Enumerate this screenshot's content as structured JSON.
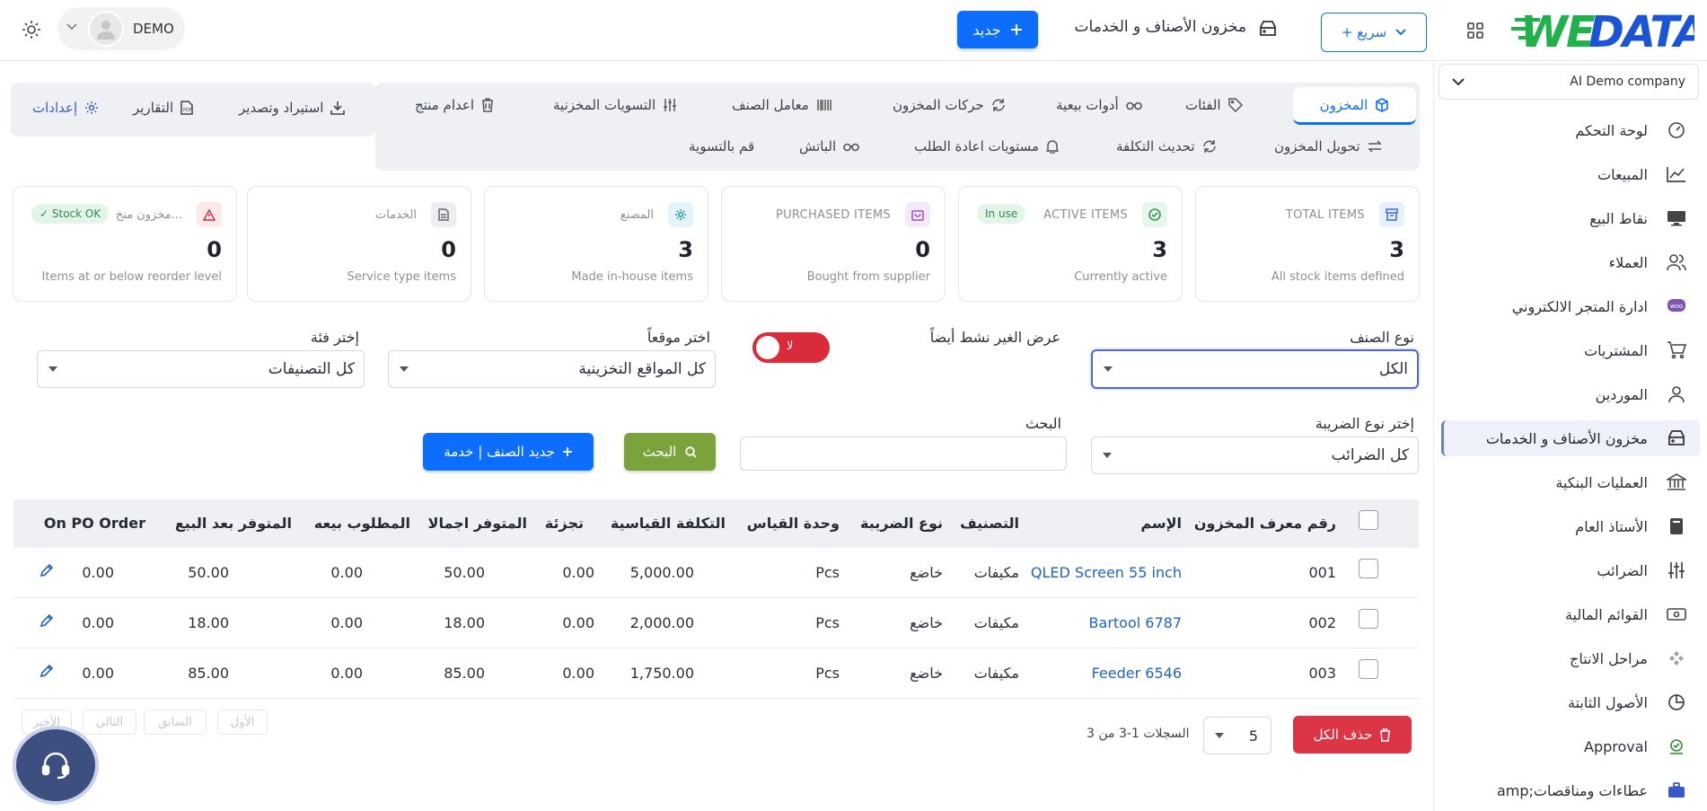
{
  "header": {
    "logo_text": "WE DATA",
    "quick_label": "+ سريع",
    "page_title": "مخزون الأصناف و الخدمات",
    "new_label": "جديد",
    "user_name": "DEMO"
  },
  "sidebar": {
    "company": "AI Demo company",
    "items": [
      {
        "label": "لوحة التحكم",
        "icon": "gauge-icon"
      },
      {
        "label": "المبيعات",
        "icon": "chart-line-icon"
      },
      {
        "label": "نقاط البيع",
        "icon": "monitor-icon"
      },
      {
        "label": "العملاء",
        "icon": "users-icon"
      },
      {
        "label": "ادارة المتجر الالكتروني",
        "icon": "woo-icon"
      },
      {
        "label": "المشتريات",
        "icon": "cart-icon"
      },
      {
        "label": "الموردين",
        "icon": "user-icon"
      },
      {
        "label": "مخزون الأصناف و الخدمات",
        "icon": "inventory-icon"
      },
      {
        "label": "العمليات البنكية",
        "icon": "bank-icon"
      },
      {
        "label": "الأستاذ العام",
        "icon": "book-icon"
      },
      {
        "label": "الضرائب",
        "icon": "sliders-icon"
      },
      {
        "label": "القوائم المالية",
        "icon": "cash-icon"
      },
      {
        "label": "مراحل الانتاج",
        "icon": "diamonds-icon"
      },
      {
        "label": "الأصول الثابتة",
        "icon": "pie-icon"
      },
      {
        "label": "Approval",
        "icon": "approval-icon"
      },
      {
        "label": "amp;عطاءات ومناقصات",
        "icon": "briefcase-icon"
      }
    ]
  },
  "tabs": {
    "row1": [
      "المخزون",
      "الفئات",
      "أدوات بيعية",
      "حركات المخزون",
      "معامل الصنف",
      "التسويات المخزنية",
      "اعدام منتج"
    ],
    "row2": [
      "تحويل المخزون",
      "تحديث التكلفة",
      "مستويات اعادة الطلب",
      "الباتش",
      "قم بالتسوية"
    ],
    "left": [
      "استيراد وتصدير",
      "التقارير",
      "إعدادات"
    ]
  },
  "cards": [
    {
      "title": "TOTAL ITEMS",
      "value": "3",
      "sub": "All stock items defined",
      "badge": ""
    },
    {
      "title": "ACTIVE ITEMS",
      "value": "3",
      "sub": "Currently active",
      "badge": "In use"
    },
    {
      "title": "PURCHASED ITEMS",
      "value": "0",
      "sub": "Bought from supplier",
      "badge": ""
    },
    {
      "title": "المصنع",
      "value": "3",
      "sub": "Made in-house items",
      "badge": ""
    },
    {
      "title": "الخدمات",
      "value": "0",
      "sub": "Service type items",
      "badge": ""
    },
    {
      "title": "مخزون منخ...",
      "value": "0",
      "sub": "Items at or below reorder level",
      "badge": "✓ Stock OK"
    }
  ],
  "filters": {
    "item_type_label": "نوع الصنف",
    "item_type_value": "الكل",
    "show_inactive_label": "عرض الغير نشط أيضاً",
    "toggle_label": "لا",
    "location_label": "اختر موقعاً",
    "location_value": "كل المواقع التخزينية",
    "category_label": "إختر فئة",
    "category_value": "كل التصنيفات",
    "tax_label": "إختر نوع الضريبة",
    "tax_value": "كل الضرائب",
    "search_label": "البحث",
    "search_btn": "البحث",
    "new_item_btn": "جديد الصنف | خدمة"
  },
  "table": {
    "headers": [
      "رقم معرف المخزون",
      "الإسم",
      "التصنيف",
      "نوع الضريبة",
      "وحدة القياس",
      "التكلفة القياسية",
      "تجزئة",
      "المتوفر اجمالا",
      "المطلوب بيعه",
      "المتوفر بعد البيع",
      "On PO Order"
    ],
    "rows": [
      [
        "001",
        "QLED Screen 55 inch",
        "مكيفات",
        "خاضع",
        "Pcs",
        "5,000.00",
        "0.00",
        "50.00",
        "0.00",
        "50.00",
        "0.00"
      ],
      [
        "002",
        "Bartool 6787",
        "مكيفات",
        "خاضع",
        "Pcs",
        "2,000.00",
        "0.00",
        "18.00",
        "0.00",
        "18.00",
        "0.00"
      ],
      [
        "003",
        "Feeder 6546",
        "مكيفات",
        "خاضع",
        "Pcs",
        "1,750.00",
        "0.00",
        "85.00",
        "0.00",
        "85.00",
        "0.00"
      ]
    ]
  },
  "pagination": {
    "delete_all": "حذف الكل",
    "page_size": "5",
    "records": "السجلات 1-3 من 3",
    "buttons": [
      "الأول",
      "السابق",
      "التالي",
      "الأخير"
    ]
  },
  "colors": {
    "primary": "#0d6efd",
    "danger": "#dc3545",
    "success": "#7aa33c",
    "toggle_off": "#d92b3a"
  }
}
